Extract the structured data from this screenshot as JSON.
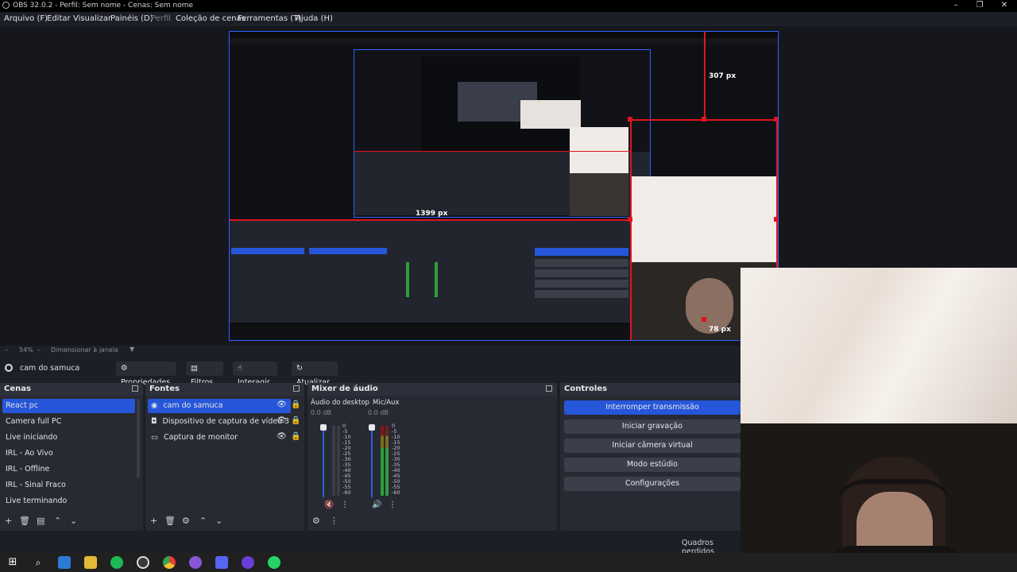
{
  "window": {
    "title": "OBS 32.0.2 - Perfil: Sem nome - Cenas: Sem nome"
  },
  "menu": {
    "items": [
      "Arquivo (F)",
      "Editar",
      "Visualizar",
      "Painéis (D)",
      "Perfil",
      "Coleção de cenas",
      "Ferramentas (T)",
      "Ajuda (H)"
    ]
  },
  "preview": {
    "labels": {
      "top_right": "307 px",
      "center": "1399 px",
      "bottom_right": "78 px"
    }
  },
  "zoom": {
    "value": "54%",
    "mode": "Dimensionar à janela"
  },
  "source_toolbar": {
    "current_source": "cam do samuca",
    "properties": "Propriedades",
    "filters": "Filtros",
    "interact": "Interagir",
    "refresh": "Atualizar"
  },
  "scenes": {
    "title": "Cenas",
    "items": [
      "React pc",
      "Camera full PC",
      "Live iniciando",
      "IRL - Ao Vivo",
      "IRL - Offline",
      "IRL - Sinal Fraco",
      "Live terminando"
    ],
    "selected": "React pc"
  },
  "sources": {
    "title": "Fontes",
    "items": [
      "cam do samuca",
      "Dispositivo de captura de vídeo 3",
      "Captura de monitor"
    ]
  },
  "mixer": {
    "title": "Mixer de áudio",
    "channels": [
      {
        "name": "Áudio do desktop",
        "level": "0.0 dB"
      },
      {
        "name": "Mic/Aux",
        "level": "0.0 dB"
      }
    ],
    "scale": [
      "0",
      "-5",
      "-10",
      "-15",
      "-20",
      "-25",
      "-30",
      "-35",
      "-40",
      "-45",
      "-50",
      "-55",
      "-60"
    ]
  },
  "controls": {
    "title": "Controles",
    "buttons": [
      "Interromper transmissão",
      "Iniciar gravação",
      "Iniciar câmera virtual",
      "Modo estúdio",
      "Configurações"
    ]
  },
  "status": {
    "dropped_frames": "Quadros perdidos"
  },
  "colors": {
    "accent": "#2656d9",
    "record_red": "#e0141e",
    "selection_blue": "#2e64ff"
  }
}
